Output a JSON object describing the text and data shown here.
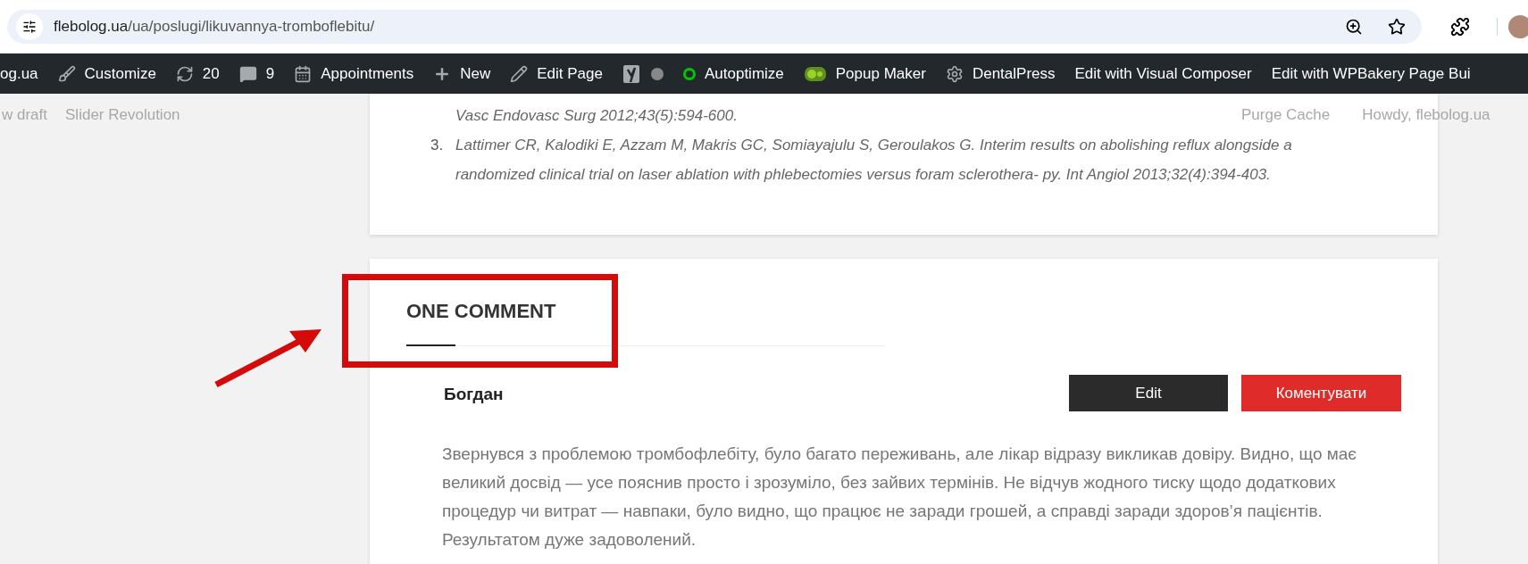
{
  "browser": {
    "url_host": "flebolog.ua",
    "url_path": "/ua/poslugi/likuvannya-tromboflebitu/"
  },
  "admin_bar": [
    {
      "kind": "text",
      "label": "og.ua"
    },
    {
      "kind": "brush",
      "label": "Customize"
    },
    {
      "kind": "refresh",
      "label": "20"
    },
    {
      "kind": "comment",
      "label": "9"
    },
    {
      "kind": "calendar",
      "label": "Appointments"
    },
    {
      "kind": "plus",
      "label": "New"
    },
    {
      "kind": "pencil",
      "label": "Edit Page"
    },
    {
      "kind": "yoast"
    },
    {
      "kind": "ring",
      "label": "Autoptimize"
    },
    {
      "kind": "popup",
      "label": "Popup Maker"
    },
    {
      "kind": "gear",
      "label": "DentalPress"
    },
    {
      "kind": "text",
      "label": "Edit with Visual Composer"
    },
    {
      "kind": "text",
      "label": "Edit with WPBakery Page Bui"
    }
  ],
  "ghost_left": [
    "w draft",
    "Slider Revolution"
  ],
  "ghost_right": [
    "Purge Cache",
    "Howdy, flebolog.ua"
  ],
  "references": [
    {
      "lines": [
        "Vasc Endovasc Surg 2012;43(5):594-600."
      ]
    },
    {
      "number": "3.",
      "lines": [
        "Lattimer CR, Kalodiki E, Azzam M, Makris GC, Somiayajulu S, Geroulakos G. Interim results on abolishing reflux alongside a",
        "randomized clinical trial on laser ablation with phlebectomies versus foram sclerothera- py. Int Angiol 2013;32(4):394-403."
      ]
    }
  ],
  "comments": {
    "title": "ONE COMMENT",
    "author": "Богдан",
    "edit_button": "Edit",
    "reply_button": "Коментувати",
    "text": "Звернувся з проблемою тромбофлебіту, було багато переживань, але лікар відразу викликав довіру. Видно, що має великий досвід — усе пояснив просто і зрозуміло, без зайвих термінів. Не відчув жодного тиску щодо додаткових процедур чи витрат — навпаки, було видно, що працює не заради грошей, а справді заради здоров’я пацієнтів. Результатом дуже задоволений."
  }
}
